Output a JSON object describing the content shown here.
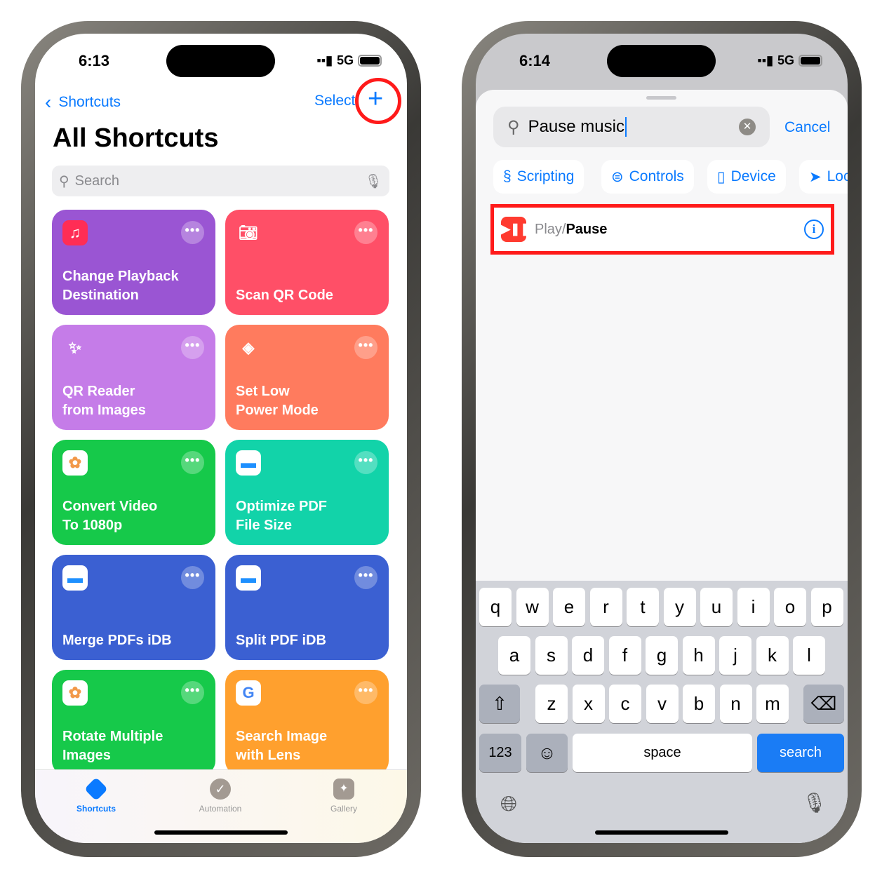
{
  "left": {
    "status": {
      "time": "6:13",
      "network": "5G"
    },
    "nav": {
      "back_label": "Shortcuts",
      "select_label": "Select",
      "add_icon": "plus-icon"
    },
    "title": "All Shortcuts",
    "search": {
      "placeholder": "Search"
    },
    "shortcuts": [
      {
        "name": "Change Playback Destination",
        "lines": [
          "Change Playback",
          "Destination"
        ],
        "color": "#9a55d3",
        "icon": "music-icon"
      },
      {
        "name": "Scan QR Code",
        "lines": [
          "",
          "Scan QR Code"
        ],
        "color": "#ff4f67",
        "icon": "camera-icon"
      },
      {
        "name": "QR Reader from Images",
        "lines": [
          "QR Reader",
          "from Images"
        ],
        "color": "#c57ce8",
        "icon": "magic-wand-icon"
      },
      {
        "name": "Set Low Power Mode",
        "lines": [
          "Set Low",
          "Power Mode"
        ],
        "color": "#ff7b5e",
        "icon": "layers-icon"
      },
      {
        "name": "Convert Video To 1080p",
        "lines": [
          "Convert Video",
          "To 1080p"
        ],
        "color": "#16c94a",
        "icon": "photos-icon"
      },
      {
        "name": "Optimize PDF File Size",
        "lines": [
          "Optimize PDF",
          "File Size"
        ],
        "color": "#12d3a9",
        "icon": "files-icon"
      },
      {
        "name": "Merge PDFs iDB",
        "lines": [
          "",
          "Merge PDFs iDB"
        ],
        "color": "#3b60d2",
        "icon": "files-icon"
      },
      {
        "name": "Split PDF iDB",
        "lines": [
          "",
          "Split PDF iDB"
        ],
        "color": "#3b60d2",
        "icon": "files-icon"
      },
      {
        "name": "Rotate Multiple Images",
        "lines": [
          "Rotate Multiple",
          "Images"
        ],
        "color": "#16c94a",
        "icon": "photos-icon"
      },
      {
        "name": "Search Image with Lens",
        "lines": [
          "Search Image",
          "with Lens"
        ],
        "color": "#ffa02e",
        "icon": "google-icon"
      }
    ],
    "tabs": [
      {
        "label": "Shortcuts",
        "active": true
      },
      {
        "label": "Automation"
      },
      {
        "label": "Gallery"
      }
    ],
    "accent": "#0a7aff",
    "highlight": "#ff1a1a"
  },
  "right": {
    "status": {
      "time": "6:14",
      "network": "5G"
    },
    "search": {
      "value": "Pause music",
      "cancel_label": "Cancel"
    },
    "chips": [
      {
        "label": "Scripting",
        "icon": "scripting-icon"
      },
      {
        "label": "Controls",
        "icon": "toggle-icon"
      },
      {
        "label": "Device",
        "icon": "phone-icon"
      },
      {
        "label": "Loc",
        "icon": "location-arrow-icon"
      }
    ],
    "result": {
      "prefix": "Play/",
      "match": "Pause",
      "icon": "play-pause-icon"
    },
    "keyboard": {
      "row1": [
        "q",
        "w",
        "e",
        "r",
        "t",
        "y",
        "u",
        "i",
        "o",
        "p"
      ],
      "row2": [
        "a",
        "s",
        "d",
        "f",
        "g",
        "h",
        "j",
        "k",
        "l"
      ],
      "row3": [
        "z",
        "x",
        "c",
        "v",
        "b",
        "n",
        "m"
      ],
      "numbers": "123",
      "space": "space",
      "search": "search"
    }
  }
}
